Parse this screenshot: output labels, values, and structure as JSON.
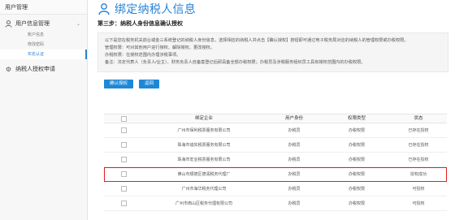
{
  "sidebar": {
    "top": "用户管理",
    "group1": "用户信息管理",
    "subitems": [
      "账户信息",
      "修改密码",
      "实名认证"
    ],
    "group2": "纳税人授权申请"
  },
  "header": {
    "title": "绑定纳税人信息",
    "step": "第三步：纳税人身份信息确认授权"
  },
  "info": {
    "line1": "以下是您在税务机关前台或金三系统登记的纳税人身份信息，选择相应的纳税人并点击【确认授权】按钮即可通过电子税务局对应的纳税人的管理权限或办税权限。",
    "line2": "管理权限：可对其他用户进行授权、解除授权、更改授权。",
    "line3": "办税权限：在授权范围内办理涉税事项。",
    "line4": "备注：法定代表人（负责人/业主）、财务负责人自备案登记后即具备全部办税权限；办税员及涉税服务组织员工具有授权范围内的办税权限。"
  },
  "buttons": {
    "confirm": "确认授权",
    "back": "返回"
  },
  "table": {
    "headers": [
      "绑定企业",
      "用户身份",
      "权限类型",
      "状态"
    ],
    "rows": [
      {
        "company": "广州市保利税票服务有限公司",
        "role": "办税员",
        "perm": "办税权限",
        "status": "已存在授权"
      },
      {
        "company": "珠海市诚实税票服务有限公司",
        "role": "办税员",
        "perm": "办税权限",
        "status": "已存在授权"
      },
      {
        "company": "珠海市宏业税票服务有限公司",
        "role": "办税员",
        "perm": "办税权限",
        "status": "已存在授权"
      },
      {
        "company": "佛山市顺德区德润税务代理厂",
        "role": "办税员",
        "perm": "办税权限",
        "status": "授权成功"
      },
      {
        "company": "广州市海华税务代理公司",
        "role": "办税员",
        "perm": "办税权限",
        "status": "可授权"
      },
      {
        "company": "广州市南山区税务代理有限公司",
        "role": "办税员",
        "perm": "办税权限",
        "status": "可授权"
      }
    ]
  },
  "colors": {
    "accent": "#2a83d6",
    "button": "#1e88d8",
    "highlight": "#e02020"
  }
}
